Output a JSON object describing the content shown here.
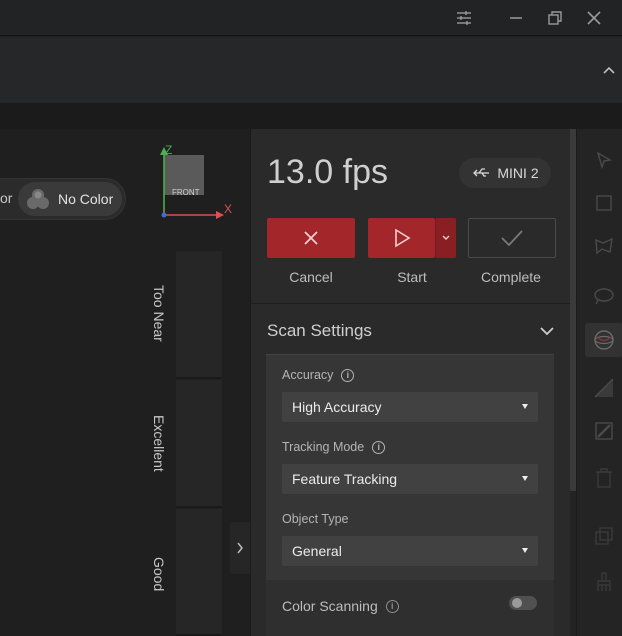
{
  "window": {
    "controls": [
      "settings-sliders",
      "minimize",
      "restore",
      "close"
    ]
  },
  "viewport": {
    "color_mode_partial": "or",
    "color_mode": "No Color",
    "axis": {
      "z": "Z",
      "x": "X",
      "cube_face": "FRONT"
    },
    "distance_quality": [
      "Too Near",
      "Excellent",
      "Good"
    ]
  },
  "scan_panel": {
    "fps": "13.0 fps",
    "device": "MINI 2",
    "buttons": {
      "cancel": "Cancel",
      "start": "Start",
      "complete": "Complete"
    },
    "section_title": "Scan Settings",
    "accuracy": {
      "label": "Accuracy",
      "value": "High Accuracy"
    },
    "tracking_mode": {
      "label": "Tracking Mode",
      "value": "Feature Tracking"
    },
    "object_type": {
      "label": "Object Type",
      "value": "General"
    },
    "color_scanning": {
      "label": "Color Scanning",
      "enabled": false
    }
  },
  "right_toolbar": [
    "select-arrow-icon",
    "rectangle-select-icon",
    "lasso-select-icon",
    "freeform-select-icon",
    "sphere-view-icon",
    "plane-cut-icon",
    "invert-icon",
    "delete-icon",
    "copy-icon",
    "brush-icon"
  ],
  "colors": {
    "accent_red": "#a3262b",
    "axis_x": "#d9534f",
    "axis_z": "#4cae4c"
  }
}
